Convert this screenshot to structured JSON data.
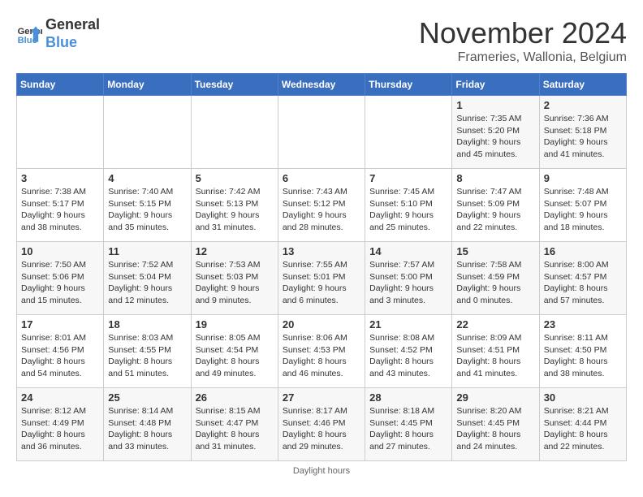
{
  "header": {
    "logo_line1": "General",
    "logo_line2": "Blue",
    "month": "November 2024",
    "location": "Frameries, Wallonia, Belgium"
  },
  "days_of_week": [
    "Sunday",
    "Monday",
    "Tuesday",
    "Wednesday",
    "Thursday",
    "Friday",
    "Saturday"
  ],
  "weeks": [
    [
      {
        "day": "",
        "info": ""
      },
      {
        "day": "",
        "info": ""
      },
      {
        "day": "",
        "info": ""
      },
      {
        "day": "",
        "info": ""
      },
      {
        "day": "",
        "info": ""
      },
      {
        "day": "1",
        "sunrise": "7:35 AM",
        "sunset": "5:20 PM",
        "daylight": "9 hours and 45 minutes."
      },
      {
        "day": "2",
        "sunrise": "7:36 AM",
        "sunset": "5:18 PM",
        "daylight": "9 hours and 41 minutes."
      }
    ],
    [
      {
        "day": "3",
        "sunrise": "7:38 AM",
        "sunset": "5:17 PM",
        "daylight": "9 hours and 38 minutes."
      },
      {
        "day": "4",
        "sunrise": "7:40 AM",
        "sunset": "5:15 PM",
        "daylight": "9 hours and 35 minutes."
      },
      {
        "day": "5",
        "sunrise": "7:42 AM",
        "sunset": "5:13 PM",
        "daylight": "9 hours and 31 minutes."
      },
      {
        "day": "6",
        "sunrise": "7:43 AM",
        "sunset": "5:12 PM",
        "daylight": "9 hours and 28 minutes."
      },
      {
        "day": "7",
        "sunrise": "7:45 AM",
        "sunset": "5:10 PM",
        "daylight": "9 hours and 25 minutes."
      },
      {
        "day": "8",
        "sunrise": "7:47 AM",
        "sunset": "5:09 PM",
        "daylight": "9 hours and 22 minutes."
      },
      {
        "day": "9",
        "sunrise": "7:48 AM",
        "sunset": "5:07 PM",
        "daylight": "9 hours and 18 minutes."
      }
    ],
    [
      {
        "day": "10",
        "sunrise": "7:50 AM",
        "sunset": "5:06 PM",
        "daylight": "9 hours and 15 minutes."
      },
      {
        "day": "11",
        "sunrise": "7:52 AM",
        "sunset": "5:04 PM",
        "daylight": "9 hours and 12 minutes."
      },
      {
        "day": "12",
        "sunrise": "7:53 AM",
        "sunset": "5:03 PM",
        "daylight": "9 hours and 9 minutes."
      },
      {
        "day": "13",
        "sunrise": "7:55 AM",
        "sunset": "5:01 PM",
        "daylight": "9 hours and 6 minutes."
      },
      {
        "day": "14",
        "sunrise": "7:57 AM",
        "sunset": "5:00 PM",
        "daylight": "9 hours and 3 minutes."
      },
      {
        "day": "15",
        "sunrise": "7:58 AM",
        "sunset": "4:59 PM",
        "daylight": "9 hours and 0 minutes."
      },
      {
        "day": "16",
        "sunrise": "8:00 AM",
        "sunset": "4:57 PM",
        "daylight": "8 hours and 57 minutes."
      }
    ],
    [
      {
        "day": "17",
        "sunrise": "8:01 AM",
        "sunset": "4:56 PM",
        "daylight": "8 hours and 54 minutes."
      },
      {
        "day": "18",
        "sunrise": "8:03 AM",
        "sunset": "4:55 PM",
        "daylight": "8 hours and 51 minutes."
      },
      {
        "day": "19",
        "sunrise": "8:05 AM",
        "sunset": "4:54 PM",
        "daylight": "8 hours and 49 minutes."
      },
      {
        "day": "20",
        "sunrise": "8:06 AM",
        "sunset": "4:53 PM",
        "daylight": "8 hours and 46 minutes."
      },
      {
        "day": "21",
        "sunrise": "8:08 AM",
        "sunset": "4:52 PM",
        "daylight": "8 hours and 43 minutes."
      },
      {
        "day": "22",
        "sunrise": "8:09 AM",
        "sunset": "4:51 PM",
        "daylight": "8 hours and 41 minutes."
      },
      {
        "day": "23",
        "sunrise": "8:11 AM",
        "sunset": "4:50 PM",
        "daylight": "8 hours and 38 minutes."
      }
    ],
    [
      {
        "day": "24",
        "sunrise": "8:12 AM",
        "sunset": "4:49 PM",
        "daylight": "8 hours and 36 minutes."
      },
      {
        "day": "25",
        "sunrise": "8:14 AM",
        "sunset": "4:48 PM",
        "daylight": "8 hours and 33 minutes."
      },
      {
        "day": "26",
        "sunrise": "8:15 AM",
        "sunset": "4:47 PM",
        "daylight": "8 hours and 31 minutes."
      },
      {
        "day": "27",
        "sunrise": "8:17 AM",
        "sunset": "4:46 PM",
        "daylight": "8 hours and 29 minutes."
      },
      {
        "day": "28",
        "sunrise": "8:18 AM",
        "sunset": "4:45 PM",
        "daylight": "8 hours and 27 minutes."
      },
      {
        "day": "29",
        "sunrise": "8:20 AM",
        "sunset": "4:45 PM",
        "daylight": "8 hours and 24 minutes."
      },
      {
        "day": "30",
        "sunrise": "8:21 AM",
        "sunset": "4:44 PM",
        "daylight": "8 hours and 22 minutes."
      }
    ]
  ],
  "footer": {
    "daylight_label": "Daylight hours"
  }
}
